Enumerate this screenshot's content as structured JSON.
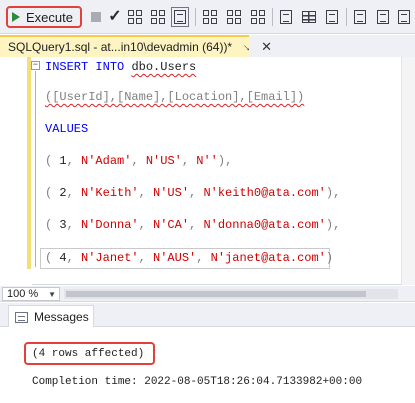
{
  "toolbar": {
    "execute_label": "Execute"
  },
  "document_tab": {
    "title": "SQLQuery1.sql - at...in10\\devadmin (64))*",
    "pin_glyph": "→",
    "close_glyph": "✕"
  },
  "editor": {
    "lines": [
      {
        "kw1": "INSERT",
        "kw2": "INTO",
        "table": "dbo.Users"
      },
      {
        "columns": "([UserId],[Name],[Location],[Email])"
      },
      {
        "kw": "VALUES"
      },
      {
        "open": "( ",
        "num": "1",
        "sep1": ", ",
        "s1": "N'Adam'",
        "sep2": ", ",
        "s2": "N'US'",
        "sep3": ", ",
        "s3": "N''",
        "close": "),"
      },
      {
        "open": "( ",
        "num": "2",
        "sep1": ", ",
        "s1": "N'Keith'",
        "sep2": ", ",
        "s2": "N'US'",
        "sep3": ", ",
        "s3": "N'keith0@ata.com'",
        "close": "),"
      },
      {
        "open": "( ",
        "num": "3",
        "sep1": ", ",
        "s1": "N'Donna'",
        "sep2": ", ",
        "s2": "N'CA'",
        "sep3": ", ",
        "s3": "N'donna0@ata.com'",
        "close": "),"
      },
      {
        "open": "( ",
        "num": "4",
        "sep1": ", ",
        "s1": "N'Janet'",
        "sep2": ", ",
        "s2": "N'AUS'",
        "sep3": ", ",
        "s3": "N'janet@ata.com'",
        "close": ")"
      }
    ]
  },
  "zoom": {
    "value": "100 %"
  },
  "results": {
    "tab_label": "Messages",
    "rows_affected": "(4 rows affected)",
    "completion": "Completion time: 2022-08-05T18:26:04.7133982+00:00"
  },
  "colors": {
    "highlight_red": "#e2413b",
    "tab_yellow": "#fdf4c1",
    "keyword_blue": "#0000ff",
    "string_red": "#d10000"
  }
}
